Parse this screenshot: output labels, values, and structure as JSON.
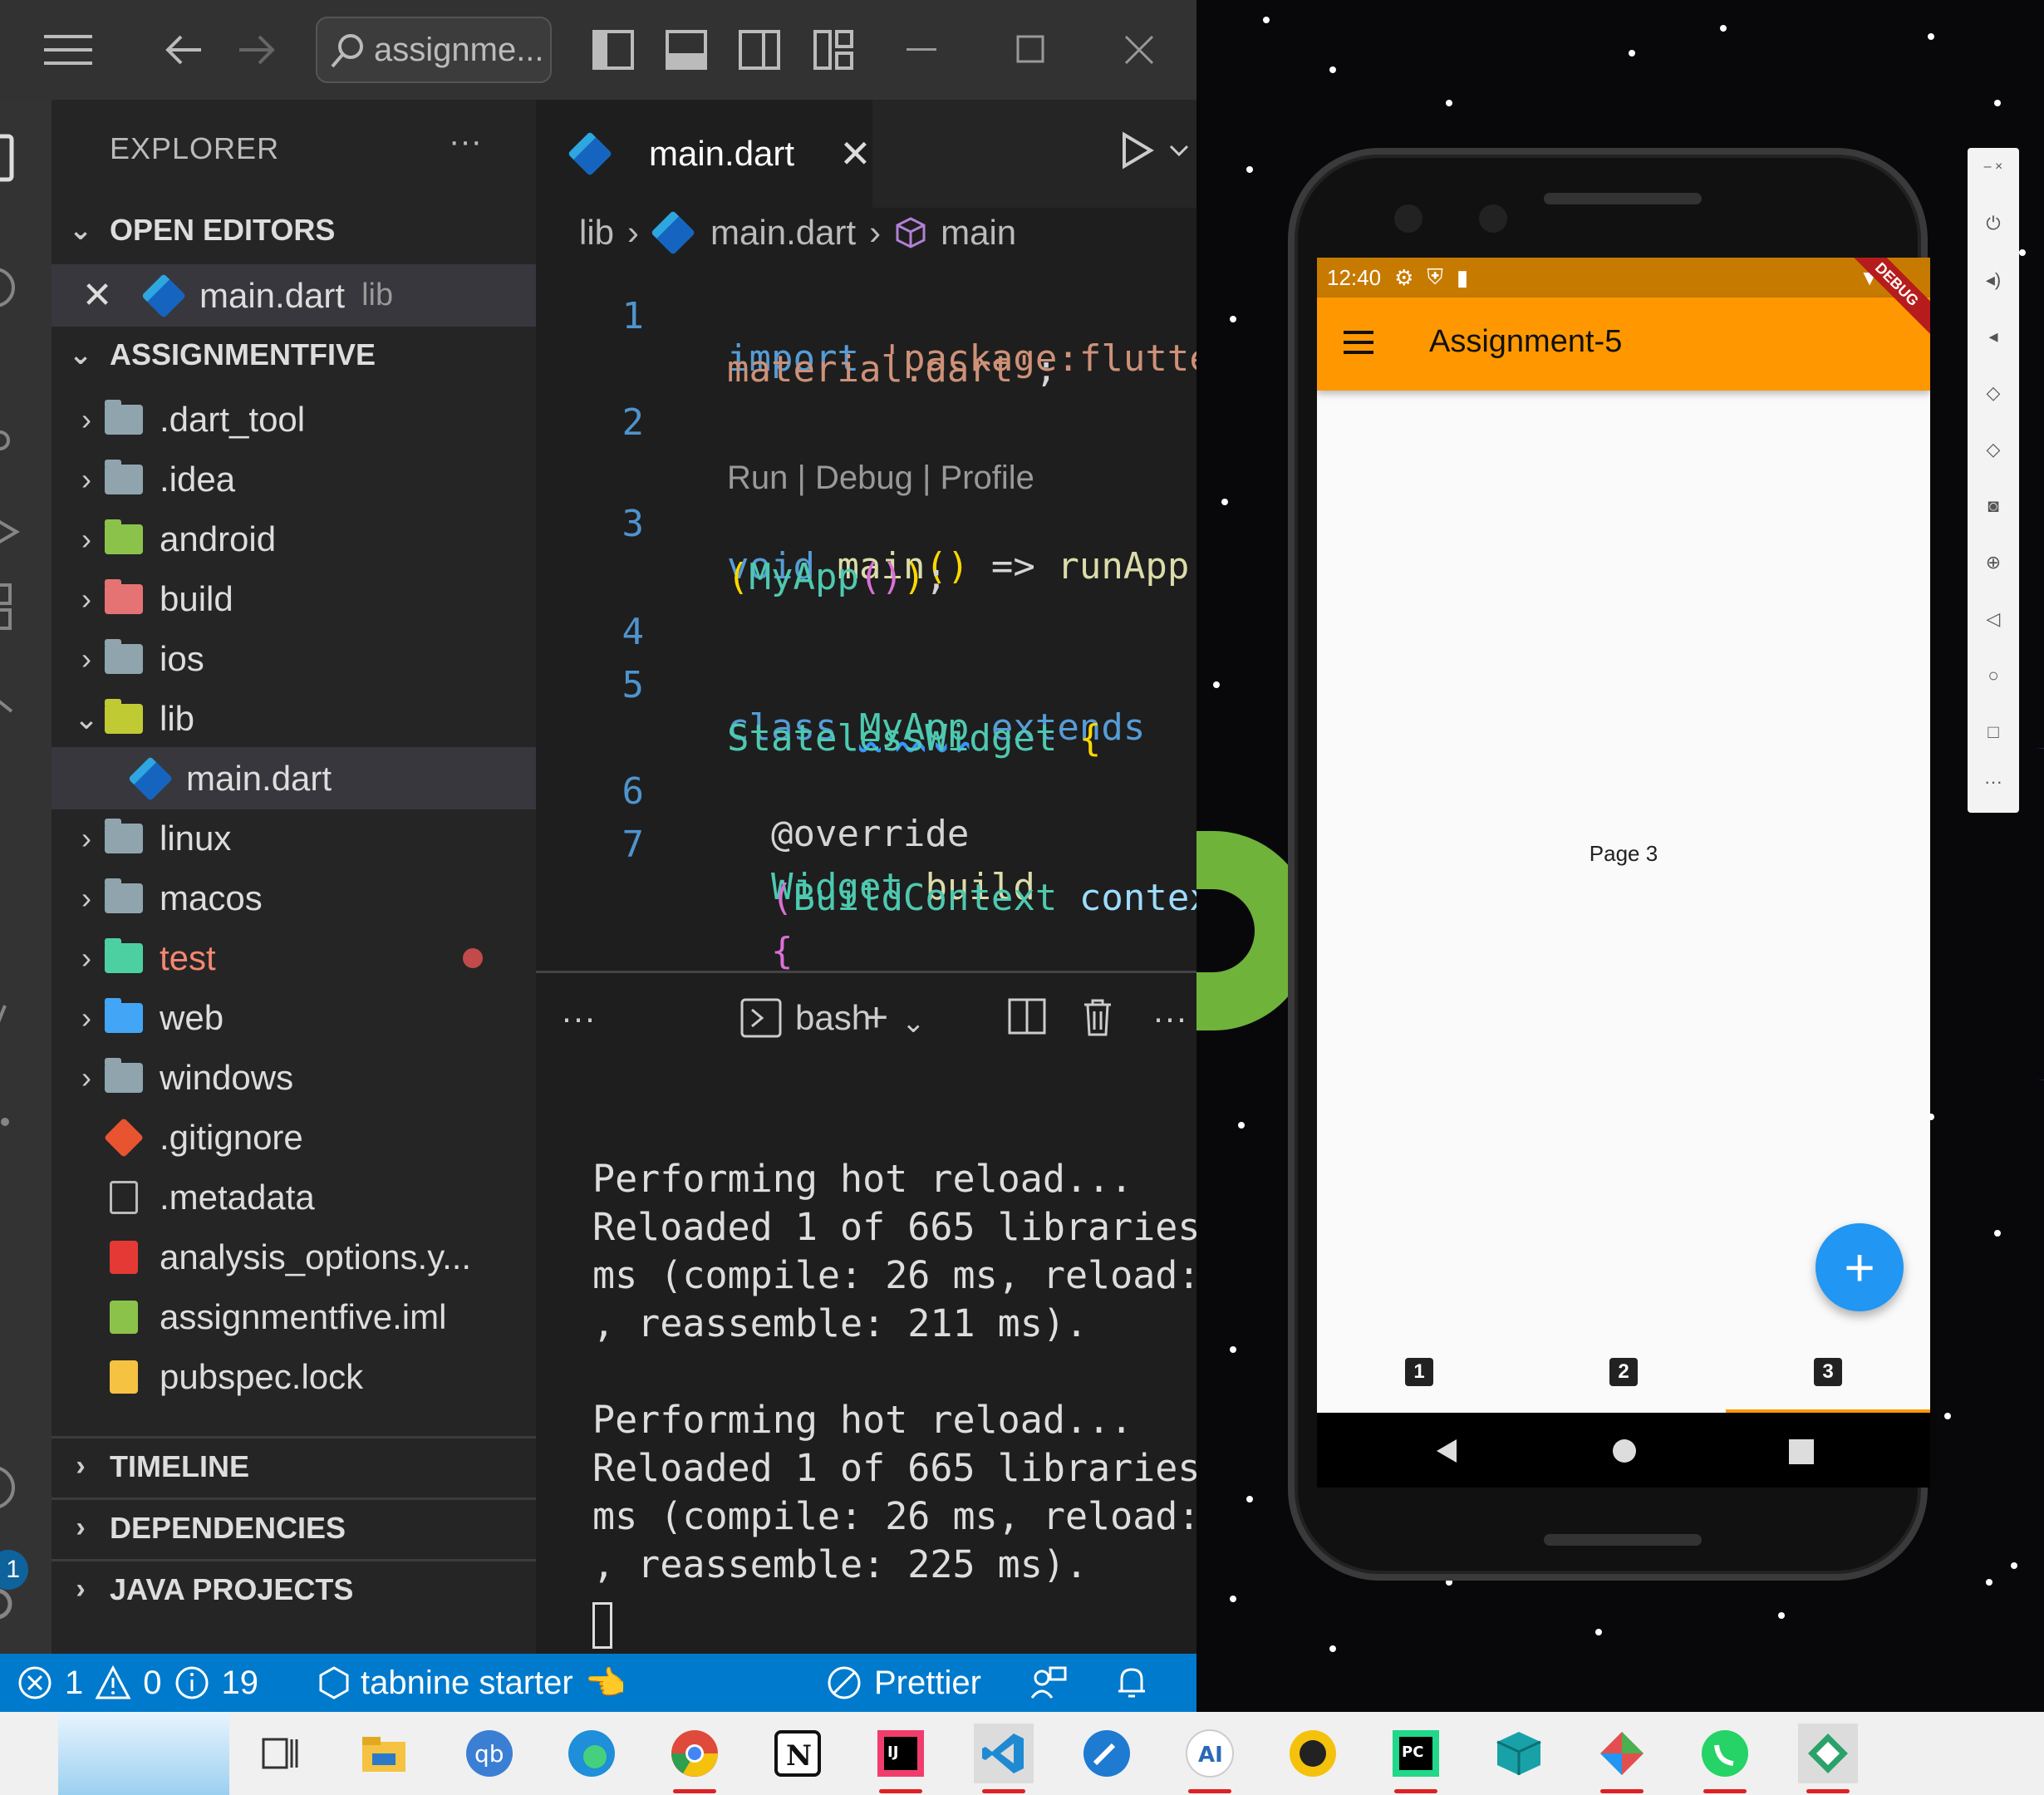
{
  "titlebar": {
    "search_text": "assignme..."
  },
  "explorer": {
    "title": "EXPLORER",
    "more": "···",
    "open_editors_label": "OPEN EDITORS",
    "open_editor": {
      "name": "main.dart",
      "dir": "lib"
    },
    "project_label": "ASSIGNMENTFIVE",
    "items": [
      {
        "name": ".dart_tool",
        "type": "folder",
        "color": "#90a4ae"
      },
      {
        "name": ".idea",
        "type": "folder",
        "color": "#90a4ae"
      },
      {
        "name": "android",
        "type": "folder",
        "color": "#8bc34a"
      },
      {
        "name": "build",
        "type": "folder",
        "color": "#e57373"
      },
      {
        "name": "ios",
        "type": "folder",
        "color": "#90a4ae"
      },
      {
        "name": "lib",
        "type": "folder-open",
        "color": "#c0ca33"
      },
      {
        "name": "main.dart",
        "type": "dart"
      },
      {
        "name": "linux",
        "type": "folder",
        "color": "#90a4ae"
      },
      {
        "name": "macos",
        "type": "folder",
        "color": "#90a4ae"
      },
      {
        "name": "test",
        "type": "folder",
        "color": "#4dd0a1"
      },
      {
        "name": "web",
        "type": "folder",
        "color": "#42a5f5"
      },
      {
        "name": "windows",
        "type": "folder",
        "color": "#90a4ae"
      },
      {
        "name": ".gitignore",
        "type": "git"
      },
      {
        "name": ".metadata",
        "type": "file"
      },
      {
        "name": "analysis_options.y...",
        "type": "yaml"
      },
      {
        "name": "assignmentfive.iml",
        "type": "iml"
      },
      {
        "name": "pubspec.lock",
        "type": "lock"
      }
    ],
    "timeline_label": "TIMELINE",
    "dependencies_label": "DEPENDENCIES",
    "java_projects_label": "JAVA PROJECTS"
  },
  "editor": {
    "tab_label": "main.dart",
    "breadcrumb": [
      "lib",
      "main.dart",
      "main"
    ],
    "codelens": "Run | Debug | Profile",
    "line_numbers": [
      "1",
      "2",
      "3",
      "4",
      "5",
      "6",
      "7"
    ]
  },
  "terminal": {
    "shell_label": "bash",
    "lines": [
      "Performing hot reload...",
      "Reloaded 1 of 665 libraries",
      "ms (compile: 26 ms, reload:",
      ", reassemble: 211 ms).",
      "",
      "Performing hot reload...",
      "Reloaded 1 of 665 libraries",
      "ms (compile: 26 ms, reload:",
      ", reassemble: 225 ms)."
    ]
  },
  "statusbar": {
    "errors": "1",
    "warnings": "0",
    "infos": "19",
    "tabnine": "tabnine starter",
    "prettier": "Prettier"
  },
  "activity": {
    "badge": "1"
  },
  "phone": {
    "time": "12:40",
    "app_title": "Assignment-5",
    "debug_banner": "DEBUG",
    "page_label": "Page 3",
    "fab_label": "+",
    "nav_items": [
      "1",
      "2",
      "3"
    ],
    "selected_nav": 2,
    "accent": "#ff9800",
    "fab_color": "#2196f3"
  }
}
